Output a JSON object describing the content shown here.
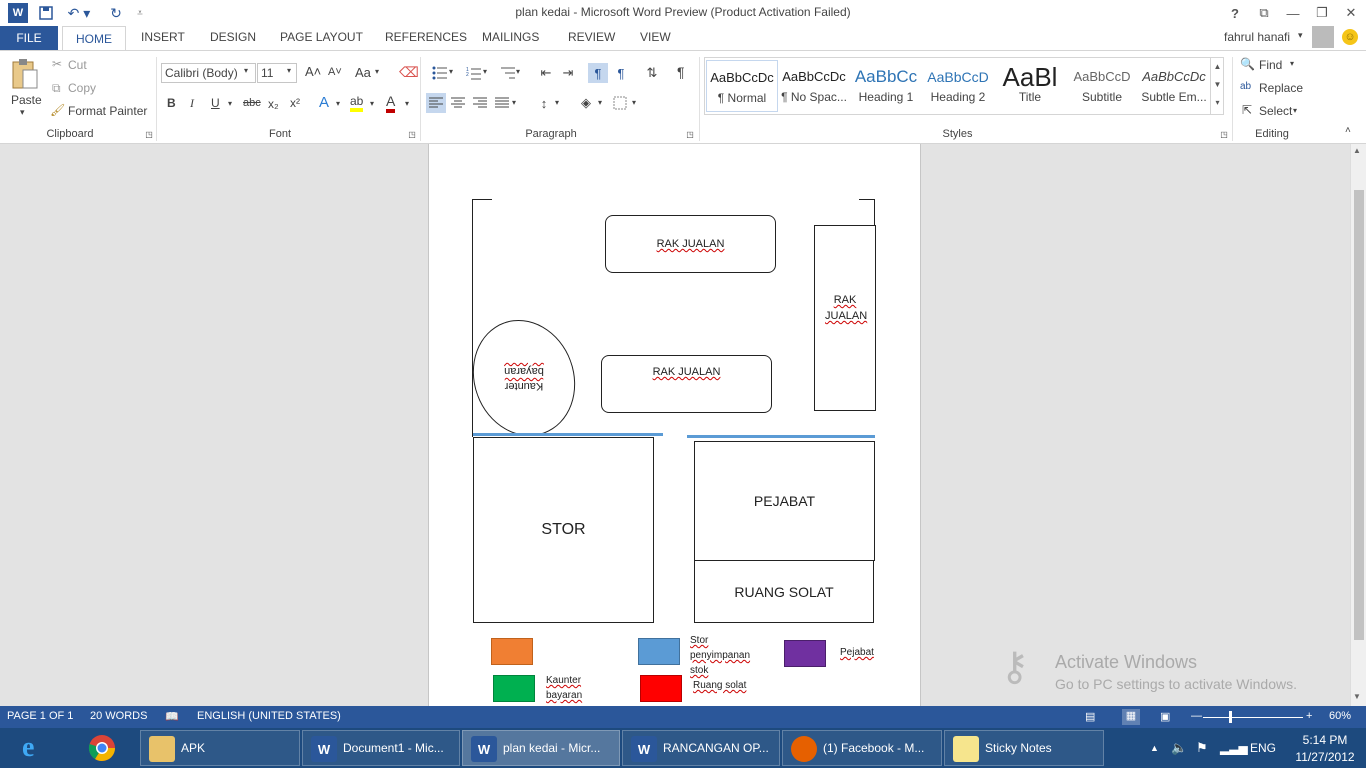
{
  "window": {
    "title": "plan kedai - Microsoft Word Preview (Product Activation Failed)"
  },
  "quick_access": {
    "icons": [
      "word-icon",
      "save-icon",
      "undo-icon",
      "redo-icon",
      "customize-icon"
    ]
  },
  "window_controls": {
    "help": "?",
    "restore_ribbon": "⧉",
    "minimize": "—",
    "maximize": "❐",
    "close": "✕"
  },
  "tabs": {
    "file": "FILE",
    "home": "HOME",
    "insert": "INSERT",
    "design": "DESIGN",
    "page_layout": "PAGE LAYOUT",
    "references": "REFERENCES",
    "mailings": "MAILINGS",
    "review": "REVIEW",
    "view": "VIEW"
  },
  "user": {
    "name": "fahrul hanafi"
  },
  "clipboard": {
    "paste": "Paste",
    "cut": "Cut",
    "copy": "Copy",
    "format_painter": "Format Painter",
    "group": "Clipboard"
  },
  "font": {
    "family": "Calibri (Body)",
    "size": "11",
    "group": "Font",
    "bold": "B",
    "italic": "I",
    "underline": "U",
    "strike": "abc",
    "sub": "x₂",
    "sup": "x²",
    "grow": "A˄",
    "shrink": "A˅",
    "case": "Aa",
    "effects": "A",
    "highlight": "ab",
    "color": "A"
  },
  "paragraph": {
    "group": "Paragraph",
    "pilcrow": "¶"
  },
  "styles": {
    "group": "Styles",
    "items": [
      {
        "preview": "AaBbCcDc",
        "name": "¶ Normal"
      },
      {
        "preview": "AaBbCcDc",
        "name": "¶ No Spac..."
      },
      {
        "preview": "AaBbCc",
        "name": "Heading 1"
      },
      {
        "preview": "AaBbCcD",
        "name": "Heading 2"
      },
      {
        "preview": "AaBl",
        "name": "Title"
      },
      {
        "preview": "AaBbCcD",
        "name": "Subtitle"
      },
      {
        "preview": "AaBbCcDc",
        "name": "Subtle Em..."
      }
    ]
  },
  "editing": {
    "group": "Editing",
    "find": "Find",
    "replace": "Replace",
    "select": "Select"
  },
  "plan": {
    "rak1": "RAK JUALAN",
    "rak2": "RAK JUALAN",
    "rak3": "RAK JUALAN",
    "kaunter": "Kaunter bayaran",
    "stor": "STOR",
    "pejabat": "PEJABAT",
    "ruang_solat": "RUANG SOLAT",
    "legend": [
      {
        "color": "#f07f33",
        "label": ""
      },
      {
        "color": "#5b9bd5",
        "label": "Stor penyimpanan stok"
      },
      {
        "color": "#7030a0",
        "label": "Pejabat"
      },
      {
        "color": "#00b050",
        "label": "Kaunter bayaran"
      },
      {
        "color": "#ff0000",
        "label": "Ruang solat"
      }
    ],
    "wall_color": "#5b9bd5"
  },
  "watermark": {
    "title": "Activate Windows",
    "subtitle": "Go to PC settings to activate Windows."
  },
  "status": {
    "page": "PAGE 1 OF 1",
    "words": "20 WORDS",
    "language": "ENGLISH (UNITED STATES)",
    "zoom": "60%"
  },
  "taskbar": {
    "items": [
      {
        "label": "APK",
        "icon": "folder-icon"
      },
      {
        "label": "Document1 - Mic...",
        "icon": "word-icon"
      },
      {
        "label": "plan kedai - Micr...",
        "icon": "word-icon"
      },
      {
        "label": "RANCANGAN OP...",
        "icon": "word-icon"
      },
      {
        "label": "(1) Facebook - M...",
        "icon": "firefox-icon"
      },
      {
        "label": "Sticky Notes",
        "icon": "sticky-notes-icon"
      }
    ],
    "lang": "ENG",
    "time": "5:14 PM",
    "date": "11/27/2012"
  }
}
